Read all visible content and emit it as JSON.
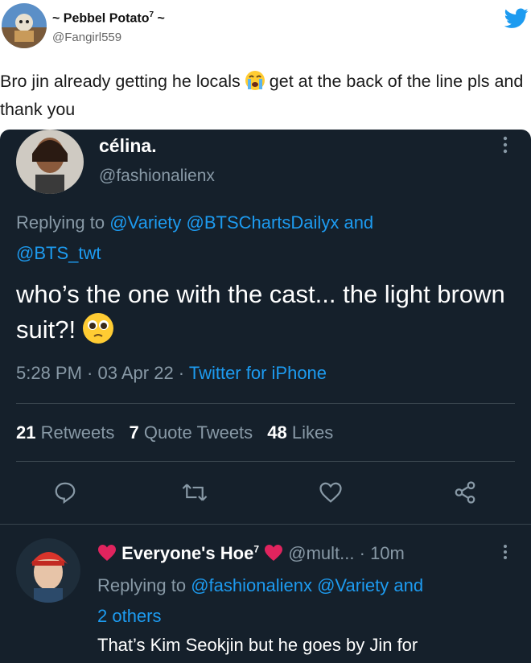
{
  "outer_tweet": {
    "display_name": "~ Pebbel Potato",
    "name_superscript": "7",
    "name_suffix": " ~",
    "handle": "@Fangirl559",
    "text_part1": "Bro jin already getting he locals",
    "text_part2": "get at the back of the line pls and thank you",
    "emoji": "crying-face-emoji"
  },
  "quoted_tweet": {
    "display_name": "célina.",
    "handle": "@fashionalienx",
    "replying_prefix": "Replying to",
    "replying_mentions": [
      "@Variety",
      "@BTSChartsDailyx"
    ],
    "replying_and": "and",
    "replying_last": "@BTS_twt",
    "text": "who’s the one with the cast... the light brown suit?!",
    "emoji": "pleading-face-emoji",
    "time": "5:28 PM",
    "date": "03 Apr 22",
    "source": "Twitter for iPhone",
    "stats": {
      "retweets_count": "21",
      "retweets_label": "Retweets",
      "quotes_count": "7",
      "quotes_label": "Quote Tweets",
      "likes_count": "48",
      "likes_label": "Likes"
    }
  },
  "reply": {
    "display_name": "Everyone's Hoe",
    "name_superscript": "7",
    "handle": "@mult...",
    "time": "10m",
    "replying_prefix": "Replying to",
    "replying_mentions": [
      "@fashionalienx",
      "@Variety"
    ],
    "replying_and": "and",
    "replying_others": "2 others",
    "text": "That’s Kim Seokjin but he goes by Jin for"
  },
  "colors": {
    "dark_bg": "#15202b",
    "accent_blue": "#1d9bf0",
    "muted_text": "#8899a6",
    "heart_red": "#e0245e"
  },
  "icons": [
    "twitter-bird-icon",
    "more-icon",
    "reply-icon",
    "retweet-icon",
    "like-icon",
    "share-icon",
    "heart-icon"
  ]
}
